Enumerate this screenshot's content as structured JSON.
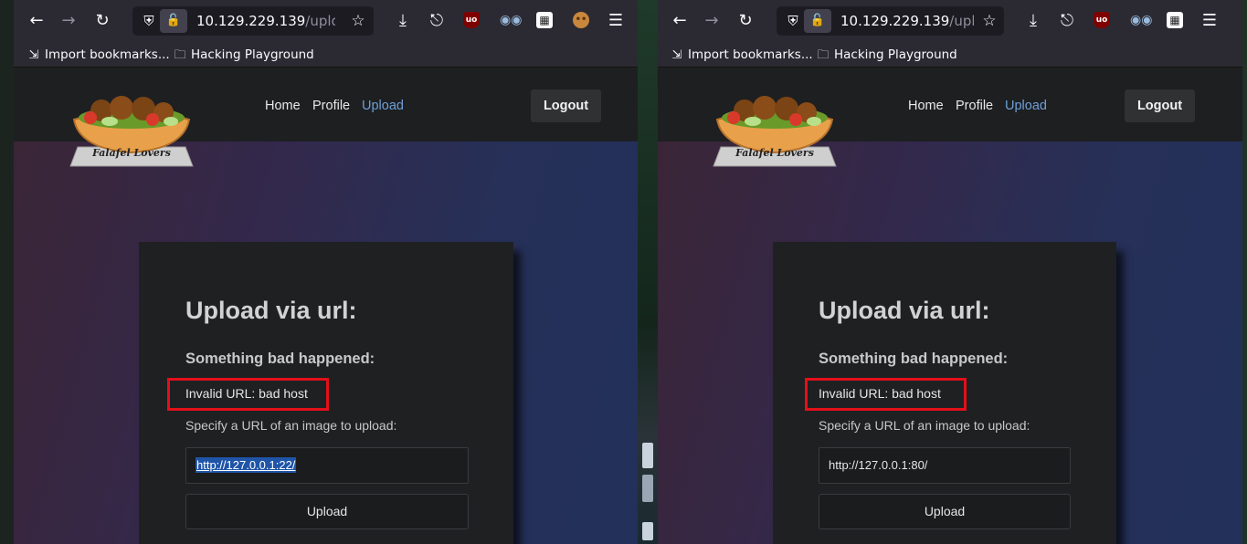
{
  "windows": [
    {
      "url_host": "10.129.229.139",
      "url_path": "/upload.p",
      "input_value": "http://127.0.0.1:22/",
      "input_selected": true
    },
    {
      "url_host": "10.129.229.139",
      "url_path": "/uploac",
      "input_value": "http://127.0.0.1:80/",
      "input_selected": false
    }
  ],
  "toolbar": {
    "back_icon": "arrow-left",
    "forward_icon": "arrow-right",
    "reload_icon": "reload",
    "shield_icon": "tracking-protection",
    "lock_icon": "insecure-lock",
    "bookmark_star_icon": "star",
    "downloads_icon": "download",
    "extensions_icon": "puzzle",
    "menu_icon": "hamburger",
    "extensions": [
      "ublock-origin",
      "glasses",
      "qr-code",
      "cookie"
    ]
  },
  "bookmarks": {
    "import_label": "Import bookmarks...",
    "folder_label": "Hacking Playground"
  },
  "site": {
    "logo_text": "Falafel Lovers",
    "nav": [
      "Home",
      "Profile",
      "Upload"
    ],
    "active_nav": "Upload",
    "logout_label": "Logout"
  },
  "form": {
    "title": "Upload via url:",
    "error_heading": "Something bad happened:",
    "error_message": "Invalid URL: bad host",
    "hint": "Specify a URL of an image to upload:",
    "upload_label": "Upload"
  },
  "colors": {
    "chrome_bg": "#2b2a33",
    "active_link": "#6f9fd8",
    "highlight_border": "#e3101a",
    "selection": "#1f55a8"
  }
}
